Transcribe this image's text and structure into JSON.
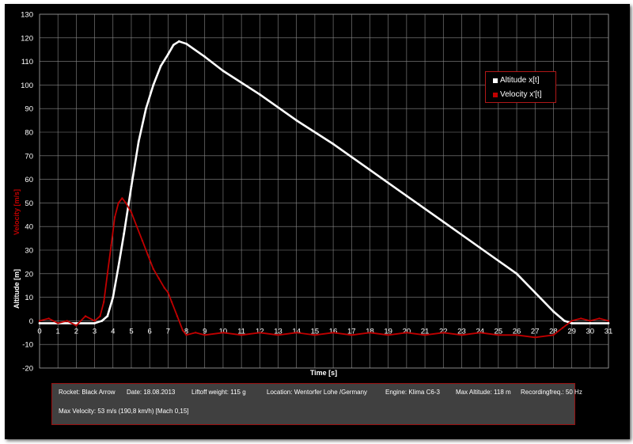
{
  "chart_data": {
    "type": "line",
    "xlabel": "Time [s]",
    "ylabel_primary": "Altitude [m]",
    "ylabel_secondary": "Velocity [m/s]",
    "xlim": [
      0,
      31
    ],
    "ylim": [
      -20,
      130
    ],
    "x_ticks": [
      "0",
      "1",
      "2",
      "3",
      "4",
      "5",
      "6",
      "7",
      "8",
      "9",
      "10",
      "11",
      "12",
      "13",
      "14",
      "15",
      "16",
      "17",
      "18",
      "19",
      "20",
      "21",
      "22",
      "23",
      "24",
      "25",
      "26",
      "27",
      "28",
      "29",
      "30",
      "31"
    ],
    "y_ticks": [
      "-20",
      "-10",
      "0",
      "10",
      "20",
      "30",
      "40",
      "50",
      "60",
      "70",
      "80",
      "90",
      "100",
      "110",
      "120",
      "130"
    ],
    "grid": true,
    "legend_position": "top-right",
    "series": [
      {
        "name": "Altitude  x[t]",
        "color": "#ffffff",
        "x": [
          0,
          1,
          2,
          3,
          3.4,
          3.7,
          4.0,
          4.3,
          4.6,
          5.0,
          5.4,
          5.8,
          6.2,
          6.6,
          7.0,
          7.3,
          7.6,
          8.0,
          9.0,
          10.0,
          12.0,
          14.0,
          16.0,
          18.0,
          20.0,
          22.0,
          24.0,
          26.0,
          27.0,
          28.0,
          28.6,
          29.0,
          30.0,
          31.0
        ],
        "values": [
          -1,
          -1,
          -1,
          -1,
          0,
          2,
          10,
          23,
          37,
          57,
          76,
          90,
          100,
          108,
          113,
          117,
          118.5,
          117.5,
          112,
          106,
          96,
          85,
          75,
          64,
          53,
          42,
          31,
          20,
          12,
          4,
          0,
          -1,
          -1,
          -1
        ]
      },
      {
        "name": "Velocity   x'[t]",
        "color": "#c00000",
        "x": [
          0,
          0.5,
          1,
          1.5,
          2,
          2.5,
          3,
          3.3,
          3.5,
          3.7,
          3.9,
          4.1,
          4.3,
          4.5,
          4.7,
          5.0,
          5.3,
          5.6,
          5.9,
          6.2,
          6.5,
          6.8,
          7.0,
          7.2,
          7.5,
          7.8,
          8.0,
          8.5,
          9,
          10,
          11,
          12,
          13,
          14,
          15,
          16,
          17,
          18,
          19,
          20,
          21,
          22,
          23,
          24,
          25,
          26,
          27,
          28,
          28.5,
          29,
          29.5,
          30,
          30.5,
          31
        ],
        "values": [
          0,
          1,
          -1,
          0,
          -2,
          2,
          0,
          2,
          8,
          20,
          32,
          44,
          50,
          52,
          50,
          46,
          40,
          34,
          28,
          22,
          18,
          14,
          12,
          8,
          2,
          -4,
          -6,
          -5,
          -6,
          -5,
          -6,
          -5,
          -6,
          -5,
          -6,
          -5,
          -6,
          -5,
          -6,
          -5,
          -6,
          -5,
          -6,
          -5,
          -6,
          -6,
          -7,
          -6,
          -3,
          0,
          1,
          0,
          1,
          0
        ]
      }
    ]
  },
  "legend": {
    "altitude_label": "Altitude  x[t]",
    "velocity_label": "Velocity   x'[t]"
  },
  "info": {
    "rocket": "Rocket: Black Arrow",
    "date": "Date: 18.08.2013",
    "liftoff": "Liftoff weight: 115 g",
    "location": "Location:  Wentorfer Lohe /Germany",
    "engine": "Engine: Klima C6-3",
    "max_altitude": "Max Altitude:  118 m",
    "recording": "Recordingfreq.: 50 Hz",
    "max_velocity": "Max Velocity:  53 m/s (190,8 km/h) [Mach 0,15]"
  }
}
